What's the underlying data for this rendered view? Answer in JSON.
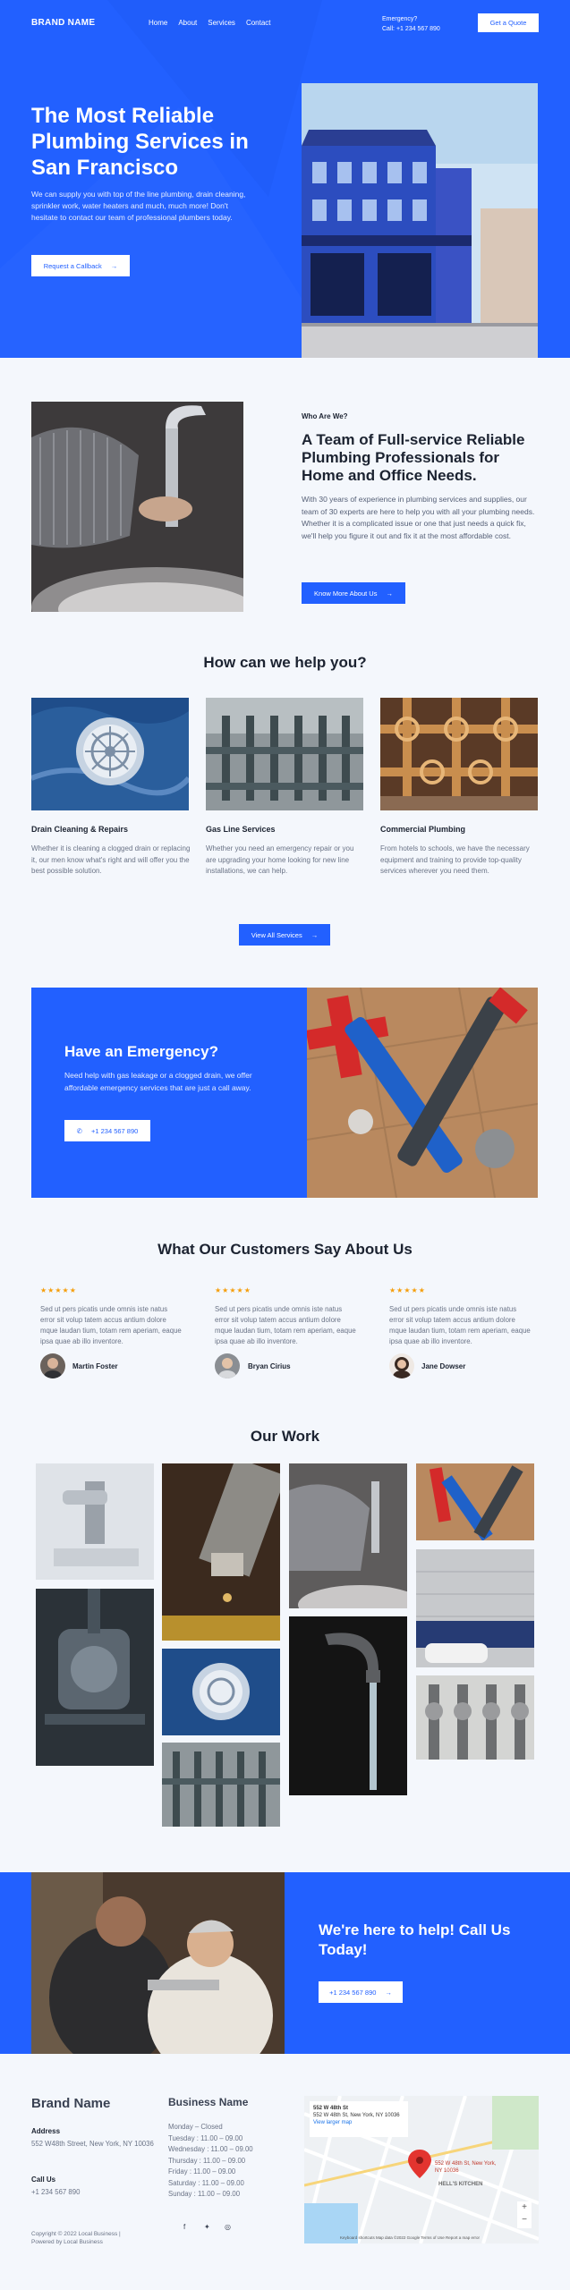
{
  "colors": {
    "primary": "#2260ff",
    "text": "#1c2331",
    "muted": "#6a7386",
    "star": "#f59e0b"
  },
  "nav": {
    "brand": "BRAND NAME",
    "links": [
      "Home",
      "About",
      "Services",
      "Contact"
    ],
    "emergency_label": "Emergency?",
    "emergency_phone": "Call: +1 234 567 890",
    "quote_button": "Get a Quote"
  },
  "hero": {
    "title": "The Most Reliable Plumbing Services in San Francisco",
    "text": "We can supply you with top of the line plumbing, drain cleaning, sprinkler work, water heaters and much, much more! Don't hesitate to contact our team of professional plumbers today.",
    "button": "Request a Callback",
    "image_icon": "blue-building-photo"
  },
  "about": {
    "eyebrow": "Who Are We?",
    "title": "A Team of Full-service Reliable Plumbing Professionals for Home and Office Needs.",
    "text": "With 30 years of experience in plumbing services and supplies, our team of 30 experts are here to help you with all your plumbing needs. Whether it is a complicated issue or one that just needs a quick fix, we'll help you figure it out and fix it at the most affordable cost.",
    "button": "Know More About Us",
    "image_icon": "plumber-fixing-faucet-photo"
  },
  "services": {
    "title": "How can we help you?",
    "items": [
      {
        "name": "Drain Cleaning & Repairs",
        "desc": "Whether it is cleaning a clogged drain or replacing it, our men know what's right and will offer you the best possible solution.",
        "image_icon": "drain-photo"
      },
      {
        "name": "Gas Line Services",
        "desc": "Whether you need an emergency repair or you are upgrading your home looking for new line installations, we can help.",
        "image_icon": "gas-pipes-photo"
      },
      {
        "name": "Commercial Plumbing",
        "desc": "From hotels to schools, we have the necessary equipment and training to provide top-quality services wherever you need them.",
        "image_icon": "copper-pipes-photo"
      }
    ],
    "button": "View All Services"
  },
  "emergency": {
    "title": "Have an Emergency?",
    "text": "Need help with gas leakage or a clogged drain, we offer affordable emergency services that are just a call away.",
    "phone": "+1 234 567 890",
    "image_icon": "pipe-wrenches-photo"
  },
  "testimonials": {
    "title": "What Our Customers Say About Us",
    "stars": "★★★★★",
    "items": [
      {
        "quote": "Sed ut pers picatis unde omnis iste natus error sit volup tatem accus antium dolore mque laudan tium, totam rem aperiam, eaque ipsa quae ab illo inventore.",
        "name": "Martin Foster"
      },
      {
        "quote": "Sed ut pers picatis unde omnis iste natus error sit volup tatem accus antium dolore mque laudan tium, totam rem aperiam, eaque ipsa quae ab illo inventore.",
        "name": "Bryan Cirius"
      },
      {
        "quote": "Sed ut pers picatis unde omnis iste natus error sit volup tatem accus antium dolore mque laudan tium, totam rem aperiam, eaque ipsa quae ab illo inventore.",
        "name": "Jane Dowser"
      }
    ]
  },
  "work": {
    "title": "Our Work"
  },
  "cta": {
    "title": "We're here to help! Call Us Today!",
    "phone": "+1 234 567 890",
    "image_icon": "plumbers-working-photo"
  },
  "footer": {
    "brand": "Brand Name",
    "address_label": "Address",
    "address": "552 W48th Street, New York, NY 10036",
    "call_label": "Call Us",
    "phone": "+1 234 567 890",
    "copyright": "Copyright © 2022 Local Business | Powered by Local Business",
    "hours_title": "Business Name",
    "hours": [
      "Monday – Closed",
      "Tuesday : 11.00 – 09.00",
      "Wednesday : 11.00 – 09.00",
      "Thursday : 11.00 – 09.00",
      "Friday : 11.00 – 09.00",
      "Saturday : 11.00 – 09.00",
      "Sunday : 11.00 – 09.00"
    ],
    "social_icons": [
      "facebook-icon",
      "twitter-icon",
      "instagram-icon"
    ],
    "map": {
      "place": "552 W 48th St",
      "place_address": "552 W 48th St, New York, NY 10036",
      "link": "View larger map",
      "pin_label": "552 W 48th St, New York, NY 10036",
      "landmark": "HELL'S KITCHEN",
      "attribution": "Keyboard shortcuts   Map data ©2022 Google   Terms of Use   Report a map error"
    }
  }
}
